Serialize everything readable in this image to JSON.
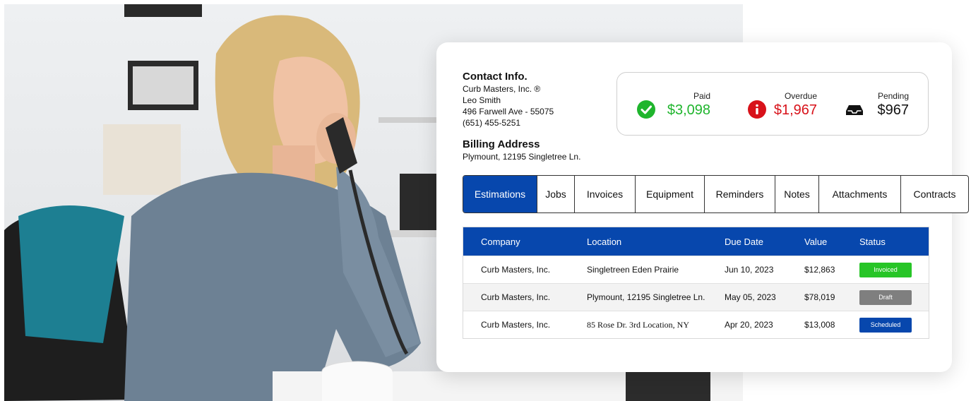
{
  "colors": {
    "brand_blue": "#0747ad",
    "paid_green": "#1fb52d",
    "overdue_red": "#d8121a",
    "invoiced_badge": "#27c527",
    "draft_badge": "#7f7f7f",
    "scheduled_badge": "#0747ad"
  },
  "contact": {
    "heading": "Contact Info.",
    "company": "Curb Masters, Inc. ®",
    "person": "Leo Smith",
    "address": "496 Farwell Ave - 55075",
    "phone": "(651) 455-5251"
  },
  "billing": {
    "heading": "Billing Address",
    "address": "Plymount, 12195 Singletree Ln."
  },
  "summary": {
    "paid": {
      "label": "Paid",
      "amount": "$3,098",
      "icon": "check-circle-icon"
    },
    "overdue": {
      "label": "Overdue",
      "amount": "$1,967",
      "icon": "info-circle-icon"
    },
    "pending": {
      "label": "Pending",
      "amount": "$967",
      "icon": "inbox-tray-icon"
    }
  },
  "tabs": [
    {
      "label": "Estimations",
      "active": true
    },
    {
      "label": "Jobs"
    },
    {
      "label": "Invoices"
    },
    {
      "label": "Equipment"
    },
    {
      "label": "Reminders"
    },
    {
      "label": "Notes"
    },
    {
      "label": "Attachments"
    },
    {
      "label": "Contracts"
    }
  ],
  "table": {
    "columns": [
      "Company",
      "Location",
      "Due Date",
      "Value",
      "Status"
    ],
    "rows": [
      {
        "company": "Curb Masters, Inc.",
        "location": "Singletreen Eden Prairie",
        "due": "Jun 10, 2023",
        "value": "$12,863",
        "status": "Invoiced"
      },
      {
        "company": "Curb Masters, Inc.",
        "location": "Plymount, 12195 Singletree Ln.",
        "due": "May 05, 2023",
        "value": "$78,019",
        "status": "Draft"
      },
      {
        "company": "Curb Masters, Inc.",
        "location": "85 Rose Dr. 3rd Location, NY",
        "due": "Apr 20, 2023",
        "value": "$13,008",
        "status": "Scheduled"
      }
    ]
  }
}
